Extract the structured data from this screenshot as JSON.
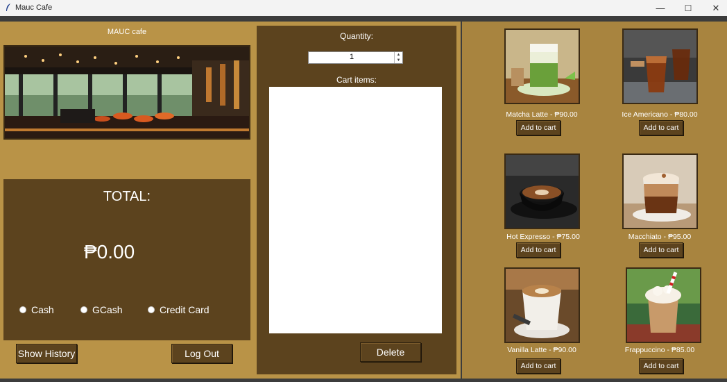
{
  "window": {
    "title": "Mauc Cafe",
    "minimize": "—",
    "maximize": "☐",
    "close": "✕"
  },
  "left": {
    "cafe_title": "MAUC cafe",
    "total_label": "TOTAL:",
    "total_amount": "₱0.00",
    "payment_methods": [
      "Cash",
      "GCash",
      "Credit Card"
    ],
    "show_history": "Show History",
    "log_out": "Log Out"
  },
  "cart": {
    "quantity_label": "Quantity:",
    "quantity_value": "1",
    "cart_items_label": "Cart items:",
    "items": [],
    "delete": "Delete"
  },
  "products": [
    {
      "label": "Matcha Latte - ₱90.00",
      "button": "Add to cart"
    },
    {
      "label": "Ice Americano - ₱80.00",
      "button": "Add to cart"
    },
    {
      "label": "Hot Expresso - ₱75.00",
      "button": "Add to cart"
    },
    {
      "label": "Macchiato - ₱95.00",
      "button": "Add to cart"
    },
    {
      "label": "Vanilla Latte - ₱90.00",
      "button": "Add to cart"
    },
    {
      "label": "Frappuccino - ₱85.00",
      "button": "Add to cart"
    }
  ]
}
